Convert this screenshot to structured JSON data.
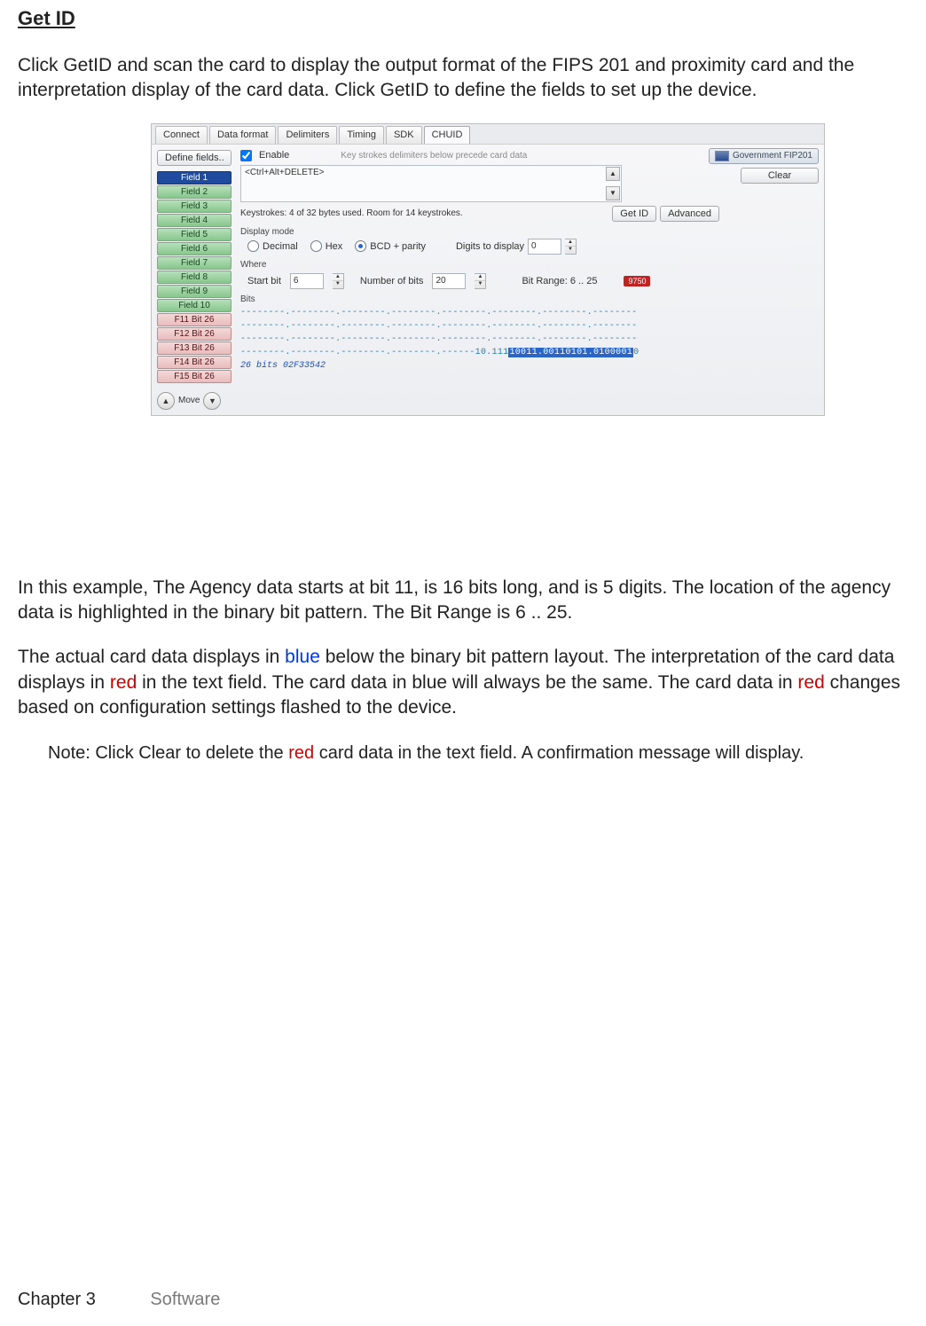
{
  "heading": "Get ID",
  "intro": "Click GetID and scan the card to display the output format of the FIPS 201 and proximity card and the interpretation display of the card data. Click GetID to define the fields to set up the device.",
  "example_para": "In this example, The Agency data starts at bit 11, is 16 bits long, and is 5 digits. The location of the agency data is highlighted in the binary bit pattern. The Bit Range is 6 .. 25.",
  "colors_para": {
    "t1": "The actual card data displays in ",
    "blue1": "blue",
    "t2": " below the binary bit pattern layout. The interpretation of the card data displays in ",
    "red1": "red",
    "t3": " in the text field. The card data in blue will always be the same. The card data in ",
    "red2": "red",
    "t4": " changes based on configuration  settings flashed to the device."
  },
  "note": {
    "prefix": "Note: Click Clear to delete the ",
    "red": "red",
    "suffix": " card data in the text field. A confirmation  message will display."
  },
  "footer": {
    "chapter": "Chapter 3",
    "section": "Software"
  },
  "app": {
    "tabs": [
      "Connect",
      "Data format",
      "Delimiters",
      "Timing",
      "SDK",
      "CHUID"
    ],
    "active_tab": "CHUID",
    "define_fields": "Define fields..",
    "fields": [
      {
        "label": "Field 1",
        "state": "selected"
      },
      {
        "label": "Field 2",
        "state": "green"
      },
      {
        "label": "Field 3",
        "state": "green"
      },
      {
        "label": "Field 4",
        "state": "green"
      },
      {
        "label": "Field 5",
        "state": "green"
      },
      {
        "label": "Field 6",
        "state": "green"
      },
      {
        "label": "Field 7",
        "state": "green"
      },
      {
        "label": "Field 8",
        "state": "green"
      },
      {
        "label": "Field 9",
        "state": "green"
      },
      {
        "label": "Field 10",
        "state": "green"
      },
      {
        "label": "F11 Bit 26",
        "state": "red"
      },
      {
        "label": "F12 Bit 26",
        "state": "red"
      },
      {
        "label": "F13 Bit 26",
        "state": "red"
      },
      {
        "label": "F14 Bit 26",
        "state": "red"
      },
      {
        "label": "F15 Bit 26",
        "state": "red"
      }
    ],
    "move_label": "Move",
    "enable_label": "Enable",
    "delim_note": "Key strokes delimiters below precede card data",
    "key_text": "<Ctrl+Alt+DELETE>",
    "gov_label": "Government FIP201",
    "clear_label": "Clear",
    "ks_info": "Keystrokes: 4 of 32 bytes used. Room for 14 keystrokes.",
    "get_id": "Get ID",
    "advanced": "Advanced",
    "display_mode": "Display mode",
    "radio_decimal": "Decimal",
    "radio_hex": "Hex",
    "radio_bcd": "BCD + parity",
    "digits_label": "Digits to display",
    "digits_value": "0",
    "where_label": "Where",
    "start_bit_label": "Start bit",
    "start_bit_value": "6",
    "num_bits_label": "Number of bits",
    "num_bits_value": "20",
    "bit_range_label": "Bit Range: 6 .. 25",
    "red_flag": "9750",
    "bits_label": "Bits",
    "bits_rows": [
      "--------.--------.--------.--------.--------.--------.--------.--------",
      "--------.--------.--------.--------.--------.--------.--------.--------",
      "--------.--------.--------.--------.--------.--------.--------.--------"
    ],
    "bits_last_prefix": "--------.--------.--------.--------.------10.111",
    "bits_last_highlight": "10011.00110101.0100001",
    "bits_last_suffix": "0",
    "bits_caption": "26 bits 02F33542"
  }
}
